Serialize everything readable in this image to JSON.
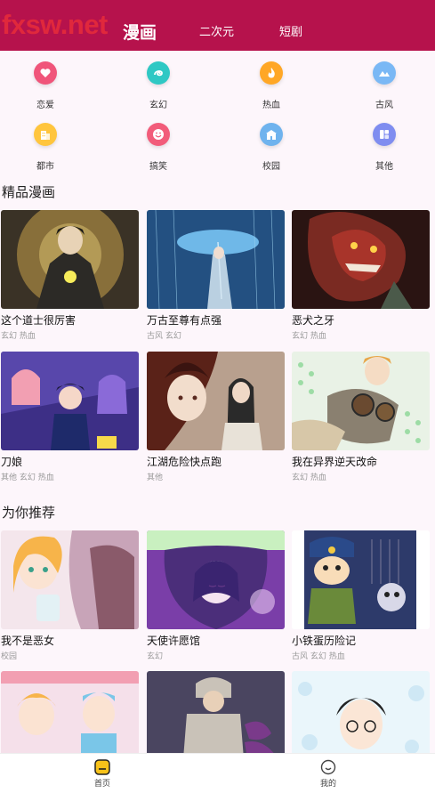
{
  "header": {
    "watermark": "fxsw.net",
    "tabs": [
      {
        "label": "漫画",
        "active": true
      },
      {
        "label": "二次元",
        "active": false
      },
      {
        "label": "短剧",
        "active": false
      }
    ],
    "bg_color": "#b6124c"
  },
  "categories": [
    {
      "label": "恋爱",
      "icon": "heart-icon",
      "color": "#f0557a"
    },
    {
      "label": "玄幻",
      "icon": "swirl-icon",
      "color": "#2fc8c4"
    },
    {
      "label": "热血",
      "icon": "flame-icon",
      "color": "#ffa726"
    },
    {
      "label": "古风",
      "icon": "mountain-icon",
      "color": "#7ab8f5"
    },
    {
      "label": "都市",
      "icon": "building-icon",
      "color": "#ffc53d"
    },
    {
      "label": "搞笑",
      "icon": "smile-icon",
      "color": "#f25c7a"
    },
    {
      "label": "校园",
      "icon": "school-icon",
      "color": "#6fb3ee"
    },
    {
      "label": "其他",
      "icon": "more-icon",
      "color": "#7f8df0"
    }
  ],
  "sections": [
    {
      "title": "精品漫画",
      "items": [
        {
          "title": "这个道士很厉害",
          "tags": "玄幻 热血",
          "palette": [
            "#5a4a30",
            "#c9a24a",
            "#2c2a26"
          ]
        },
        {
          "title": "万古至尊有点强",
          "tags": "古风 玄幻",
          "palette": [
            "#1c3f6e",
            "#6fb8e8",
            "#0e1f38"
          ]
        },
        {
          "title": "恶犬之牙",
          "tags": "玄幻 热血",
          "palette": [
            "#4a1a16",
            "#a8342a",
            "#1c1210"
          ]
        },
        {
          "title": "刀娘",
          "tags": "其他 玄幻 热血",
          "palette": [
            "#4b3b9c",
            "#f29fb2",
            "#241c4a"
          ]
        },
        {
          "title": "江湖危险快点跑",
          "tags": "其他",
          "palette": [
            "#7a2c22",
            "#e8c0a4",
            "#3a1c18"
          ]
        },
        {
          "title": "我在异界逆天改命",
          "tags": "玄幻 热血",
          "palette": [
            "#6e8a6a",
            "#d7c7a8",
            "#2a2a2a"
          ]
        }
      ]
    },
    {
      "title": "为你推荐",
      "items": [
        {
          "title": "我不是恶女",
          "tags": "校园",
          "palette": [
            "#e8c2cf",
            "#f7b44a",
            "#8a5a6a"
          ]
        },
        {
          "title": "天使许愿馆",
          "tags": "玄幻",
          "palette": [
            "#9a5cc8",
            "#4b2e7a",
            "#e6c8f0"
          ]
        },
        {
          "title": "小铁蛋历险记",
          "tags": "古风 玄幻 热血",
          "palette": [
            "#2d3a6a",
            "#f2c944",
            "#6a8a3a"
          ]
        },
        {
          "title": "",
          "tags": "",
          "palette": [
            "#f2b3c6",
            "#7ac6e8",
            "#f7d96a"
          ]
        },
        {
          "title": "",
          "tags": "",
          "palette": [
            "#4a4560",
            "#c9c2b8",
            "#7a3a8a"
          ]
        },
        {
          "title": "",
          "tags": "",
          "palette": [
            "#cfe8f5",
            "#ffffff",
            "#222222"
          ]
        }
      ]
    }
  ],
  "bottom_nav": [
    {
      "label": "首页",
      "icon": "home-icon",
      "active": true
    },
    {
      "label": "我的",
      "icon": "profile-icon",
      "active": false
    }
  ]
}
